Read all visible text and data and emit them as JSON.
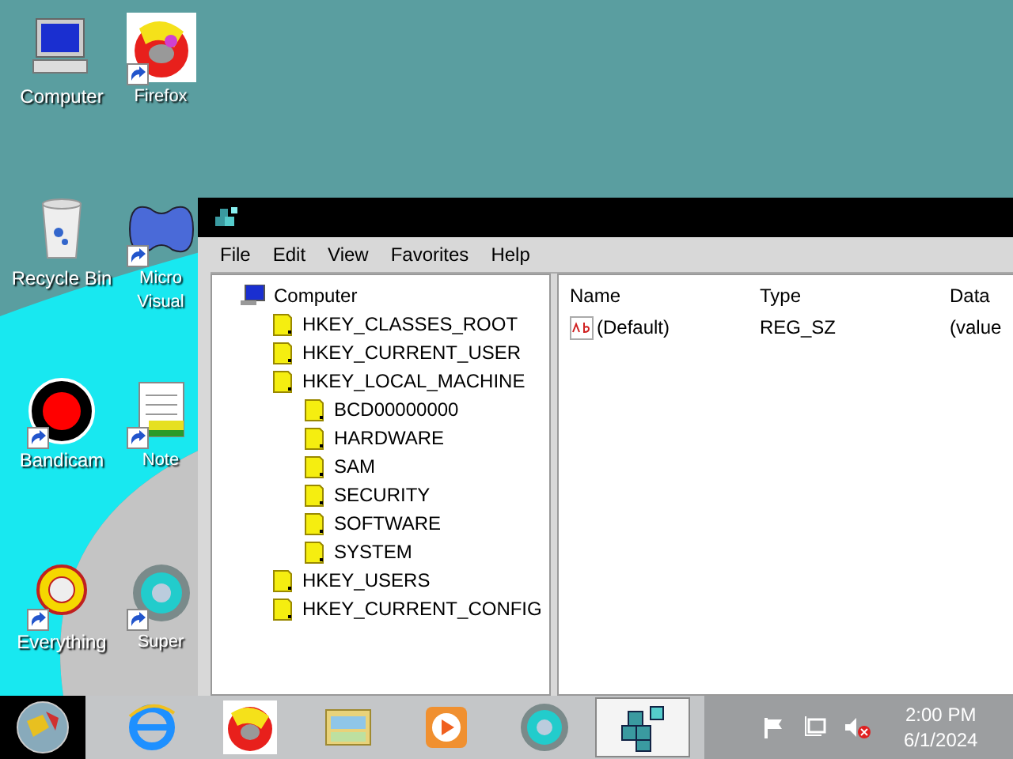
{
  "desktop_icons": [
    {
      "kind": "computer",
      "lines": [
        "Computer"
      ],
      "shortcut": false
    },
    {
      "kind": "firefox",
      "lines": [
        "Firefox"
      ],
      "shortcut": true
    },
    {
      "kind": "recycle",
      "lines": [
        "Recycle Bin"
      ],
      "shortcut": false
    },
    {
      "kind": "infinity",
      "lines": [
        "Micro",
        "Visual"
      ],
      "shortcut": true
    },
    {
      "kind": "record",
      "lines": [
        "Bandicam"
      ],
      "shortcut": true
    },
    {
      "kind": "notepad",
      "lines": [
        "Note"
      ],
      "shortcut": true
    },
    {
      "kind": "ring",
      "lines": [
        "Everything"
      ],
      "shortcut": true
    },
    {
      "kind": "disc",
      "lines": [
        "Super"
      ],
      "shortcut": true
    }
  ],
  "window": {
    "menu": [
      "File",
      "Edit",
      "View",
      "Favorites",
      "Help"
    ],
    "tree": {
      "label": "Computer",
      "kind": "computer",
      "children": [
        {
          "label": "HKEY_CLASSES_ROOT",
          "kind": "folder"
        },
        {
          "label": "HKEY_CURRENT_USER",
          "kind": "folder"
        },
        {
          "label": "HKEY_LOCAL_MACHINE",
          "kind": "folder",
          "children": [
            {
              "label": "BCD00000000",
              "kind": "folder"
            },
            {
              "label": "HARDWARE",
              "kind": "folder"
            },
            {
              "label": "SAM",
              "kind": "folder"
            },
            {
              "label": "SECURITY",
              "kind": "folder"
            },
            {
              "label": "SOFTWARE",
              "kind": "folder"
            },
            {
              "label": "SYSTEM",
              "kind": "folder"
            }
          ]
        },
        {
          "label": "HKEY_USERS",
          "kind": "folder"
        },
        {
          "label": "HKEY_CURRENT_CONFIG",
          "kind": "folder"
        }
      ]
    },
    "list": {
      "columns": [
        "Name",
        "Type",
        "Data"
      ],
      "rows": [
        {
          "name": "(Default)",
          "type": "REG_SZ",
          "data": "(value"
        }
      ]
    }
  },
  "taskbar": {
    "apps": [
      {
        "kind": "browser-e",
        "selected": false
      },
      {
        "kind": "firefox",
        "selected": false
      },
      {
        "kind": "folder",
        "selected": false
      },
      {
        "kind": "player",
        "selected": false
      },
      {
        "kind": "disc",
        "selected": false
      },
      {
        "kind": "cubes",
        "selected": true
      }
    ],
    "clock": {
      "time": "2:00 PM",
      "date": "6/1/2024"
    }
  }
}
